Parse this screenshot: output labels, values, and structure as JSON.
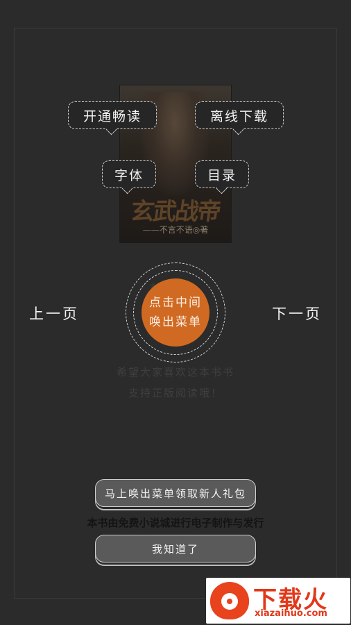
{
  "book": {
    "cover_title": "玄武战帝",
    "cover_author": "——不言不语◎著",
    "chapter_peek": "玄武战帝"
  },
  "menu_tips": {
    "open_reading": "开通畅读",
    "offline_download": "离线下载",
    "font": "字体",
    "toc": "目录"
  },
  "paging": {
    "prev": "上一页",
    "next": "下一页"
  },
  "center": {
    "line1": "点击中间",
    "line2": "唤出菜单"
  },
  "page_text": {
    "line1": "希望大家喜欢这本书书",
    "line2": "支持正版阅读哦！"
  },
  "actions": {
    "gift_label": "马上唤出菜单领取新人礼包",
    "notice": "本书由免费小说城进行电子制作与发行",
    "got_it_label": "我知道了"
  },
  "watermark": {
    "brand": "下载火",
    "domain": "xiazaihuo.com"
  },
  "colors": {
    "background": "#2b2b2b",
    "accent": "#d06a22",
    "watermark": "#e2381a"
  }
}
